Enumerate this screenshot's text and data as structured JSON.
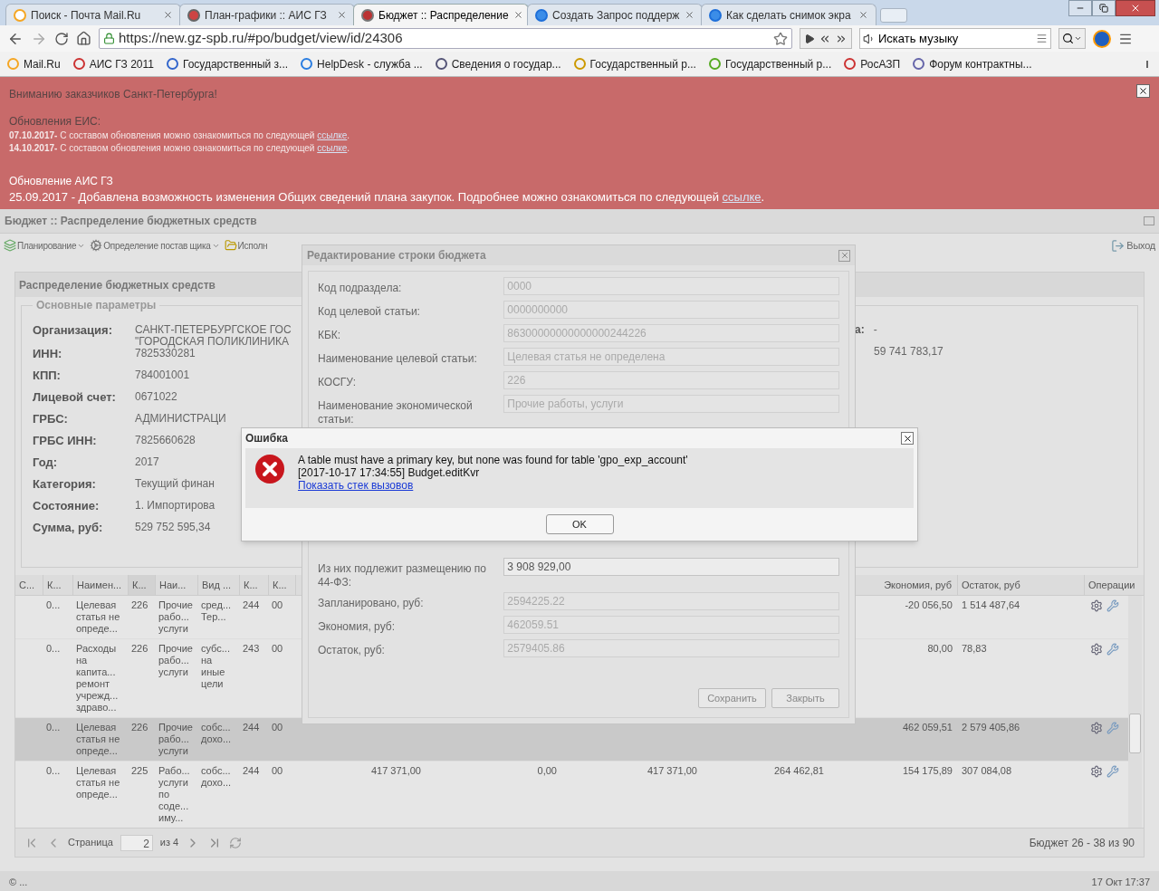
{
  "browser": {
    "tabs": [
      {
        "title": "Поиск - Почта Mail.Ru",
        "selected": false
      },
      {
        "title": "План-графики :: АИС ГЗ",
        "selected": false
      },
      {
        "title": "Бюджет :: Распределение",
        "selected": true
      },
      {
        "title": "Создать Запрос поддерж",
        "selected": false
      },
      {
        "title": "Как сделать снимок экра",
        "selected": false
      }
    ],
    "url": "https://new.gz-spb.ru/#po/budget/view/id/24306",
    "music_search": "Искать музыку",
    "bookmarks": [
      "Mail.Ru",
      "АИС ГЗ 2011",
      "Государственный з...",
      "HelpDesk - служба ...",
      "Сведения о государ...",
      "Государственный р...",
      "Государственный р...",
      "РосАЗП",
      "Форум контрактны..."
    ]
  },
  "banner": {
    "title": "Вниманию заказчиков Санкт-Петербурга!",
    "eis_heading": "Обновления ЕИС:",
    "eis_updates": [
      {
        "text": "**07.10.2017-** С составом обновления можно ознакомиться по следующей",
        "link": "ссылке",
        "end": "."
      },
      {
        "text": "**14.10.2017-** С составом обновления можно ознакомиться по следующей",
        "link": "ссылке",
        "end": "."
      }
    ],
    "ais_heading": "Обновление АИС ГЗ",
    "ais_update": {
      "text": "25.09.2017 - Добавлена возможность изменения Общих сведений плана закупок. Подробнее можно ознакомиться по следующей",
      "link": "ссылке",
      "end": "."
    }
  },
  "app": {
    "title": "Бюджет :: Распределение бюджетных средств",
    "toolbar": [
      {
        "label": "Планирование",
        "dropdown": true
      },
      {
        "label": "Определение постав щика",
        "dropdown": true
      },
      {
        "label": "Исполн",
        "dropdown": false
      }
    ],
    "exit": "Выход"
  },
  "panel": {
    "title": "Распределение бюджетных средств",
    "fieldset": "Основные параметры",
    "params": [
      {
        "label": "Организация:",
        "value": "САНКТ-ПЕТЕРБУРГСКОЕ ГОС\n\"ГОРОДСКАЯ ПОЛИКЛИНИКА"
      },
      {
        "label": "ИНН:",
        "value": "7825330281"
      },
      {
        "label": "КПП:",
        "value": "784001001"
      },
      {
        "label": "Лицевой счет:",
        "value": "0671022"
      },
      {
        "label": "ГРБС:",
        "value": "АДМИНИСТРАЦИ"
      },
      {
        "label": "ГРБС ИНН:",
        "value": "7825660628"
      },
      {
        "label": "Год:",
        "value": "2017"
      },
      {
        "label": "Категория:",
        "value": "Текущий финан"
      },
      {
        "label": "Состояние:",
        "value": "1. Импортирова"
      },
      {
        "label": "Сумма, руб:",
        "value": "529 752 595,34"
      }
    ],
    "right_label": "а:",
    "right_values": [
      "-",
      "59 741 783,17"
    ]
  },
  "table": {
    "columns": [
      "С...",
      "К...",
      "Наимен...",
      "К...",
      "Наи...",
      "Вид ...",
      "К...",
      "К...",
      "Экономия, руб",
      "Остаток, руб",
      "Операции"
    ],
    "rows": [
      {
        "cells": [
          "",
          "0...",
          "Целевая\nстатья не\nопреде...",
          "226",
          "Прочие\nрабо...\nуслуги",
          "сред...\nТер...",
          "244",
          "00"
        ],
        "amounts": [],
        "economy": "-20 056,50",
        "remainder": "1 514 487,64",
        "selected": false
      },
      {
        "cells": [
          "",
          "0...",
          "Расходы\nна\nкапита...\nремонт\nучрежд...\nздраво...",
          "226",
          "Прочие\nрабо...\nуслуги",
          "субс...\nна\nиные\nцели",
          "243",
          "00"
        ],
        "amounts": [],
        "economy": "80,00",
        "remainder": "78,83",
        "selected": false
      },
      {
        "cells": [
          "",
          "0...",
          "Целевая\nстатья не\nопреде...",
          "226",
          "Прочие\nрабо...\nуслуги",
          "собс...\nдохо...",
          "244",
          "00"
        ],
        "amounts": [],
        "economy": "462 059,51",
        "remainder": "2 579 405,86",
        "selected": true
      },
      {
        "cells": [
          "",
          "0...",
          "Целевая\nстатья не\nопреде...",
          "225",
          "Рабо...\nуслуги\nпо\nсоде...\nиму...",
          "собс...\nдохо...",
          "244",
          "00"
        ],
        "amounts": [
          "417 371,00",
          "0,00",
          "417 371,00",
          "264 462,81"
        ],
        "economy": "154 175,89",
        "remainder": "307 084,08",
        "selected": false
      }
    ]
  },
  "pager": {
    "page_label": "Страница",
    "page": "2",
    "of": "из 4",
    "summary": "Бюджет 26 - 38 из 90"
  },
  "status": {
    "left": "© ...",
    "right": "17 Окт 17:37"
  },
  "edit_dialog": {
    "title": "Редактирование строки бюджета",
    "fields_top": [
      {
        "label": "Код подраздела:",
        "value": "0000",
        "disabled": true
      },
      {
        "label": "Код целевой статьи:",
        "value": "0000000000",
        "disabled": true
      },
      {
        "label": "КБК:",
        "value": "86300000000000000244226",
        "disabled": true
      },
      {
        "label": "Наименование целевой статьи:",
        "value": "Целевая статья не определена",
        "disabled": true
      },
      {
        "label": "КОСГУ:",
        "value": "226",
        "disabled": true
      },
      {
        "label": "Наименование экономической статьи:",
        "value": "Прочие работы, услуги",
        "disabled": true
      }
    ],
    "fields_bottom": [
      {
        "label": "Из них подлежит размещению по 44-ФЗ:",
        "value": "3 908 929,00",
        "disabled": false
      },
      {
        "label": "Запланировано, руб:",
        "value": "2594225.22",
        "disabled": true
      },
      {
        "label": "Экономия, руб:",
        "value": "462059.51",
        "disabled": true
      },
      {
        "label": "Остаток, руб:",
        "value": "2579405.86",
        "disabled": true
      }
    ],
    "buttons": [
      "Сохранить",
      "Закрыть"
    ]
  },
  "error_dialog": {
    "title": "Ошибка",
    "message": "A table must have a primary key, but none was found for table 'gpo_exp_account'",
    "detail": "[2017-10-17 17:34:55] Budget.editKvr",
    "link": "Показать стек вызовов",
    "button": "OK"
  }
}
